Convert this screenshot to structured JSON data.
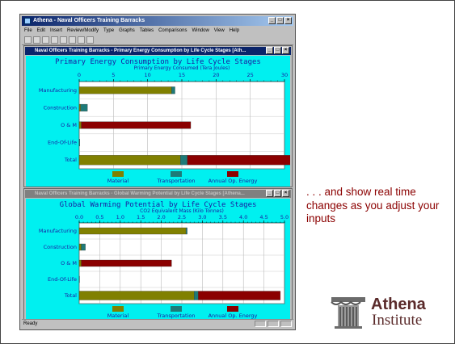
{
  "app": {
    "title": "Athena - Naval Officers Training Barracks",
    "menu": [
      "File",
      "Edit",
      "Insert",
      "Review/Modify",
      "Type",
      "Graphs",
      "Tables",
      "Comparisons",
      "Window",
      "View",
      "Help"
    ],
    "status": "Ready",
    "window_buttons": [
      "_",
      "□",
      "×"
    ]
  },
  "windows": [
    {
      "title": "Naval Officers Training Barracks - Primary Energy Consumption by Life Cycle Stages [Ath...",
      "active": true
    },
    {
      "title": "Naval Officers Training Barracks - Global Warming Potential by Life Cycle Stages [Athena...",
      "active": false
    }
  ],
  "chart_data": [
    {
      "type": "bar",
      "stacked": true,
      "orientation": "horizontal",
      "title": "Primary Energy Consumption by Life Cycle Stages",
      "xlabel": "Primary Energy Consumed (Tera Joules)",
      "xlim": [
        0,
        30
      ],
      "tick_labels": [
        "0",
        "5",
        "10",
        "15",
        "20",
        "25",
        "30"
      ],
      "categories": [
        "Manufacturing",
        "Construction",
        "O & M",
        "End-Of-Life",
        "Total"
      ],
      "series": [
        {
          "name": "Material",
          "color": "#808000",
          "values": [
            13.5,
            0.2,
            0.3,
            0,
            14.8
          ]
        },
        {
          "name": "Transportation",
          "color": "#1e7a78",
          "values": [
            0.5,
            1.0,
            0,
            0.1,
            1.0
          ]
        },
        {
          "name": "Annual Op. Energy",
          "color": "#8b0000",
          "values": [
            0,
            0,
            16.0,
            0,
            15.8
          ]
        }
      ],
      "grid": true,
      "legend": "bottom"
    },
    {
      "type": "bar",
      "stacked": true,
      "orientation": "horizontal",
      "title": "Global Warming Potential by Life Cycle Stages",
      "xlabel": "CO2 Equivalent Mass (Kilo Tonnes)",
      "xlim": [
        0,
        5.0
      ],
      "tick_labels": [
        "0.0",
        "0.5",
        "1.0",
        "1.5",
        "2.0",
        "2.5",
        "3.0",
        "3.5",
        "4.0",
        "4.5",
        "5.0"
      ],
      "categories": [
        "Manufacturing",
        "Construction",
        "O & M",
        "End-Of-Life",
        "Total"
      ],
      "series": [
        {
          "name": "Material",
          "color": "#808000",
          "values": [
            2.6,
            0.05,
            0.05,
            0,
            2.8
          ]
        },
        {
          "name": "Transportation",
          "color": "#1e7a78",
          "values": [
            0.03,
            0.1,
            0,
            0.01,
            0.1
          ]
        },
        {
          "name": "Annual Op. Energy",
          "color": "#8b0000",
          "values": [
            0,
            0,
            2.2,
            0,
            2.0
          ]
        }
      ],
      "grid": true,
      "legend": "bottom"
    }
  ],
  "side_text": ". . . and show real time changes as you adjust your inputs",
  "logo": {
    "word": "Athena",
    "sub": "Institute"
  }
}
